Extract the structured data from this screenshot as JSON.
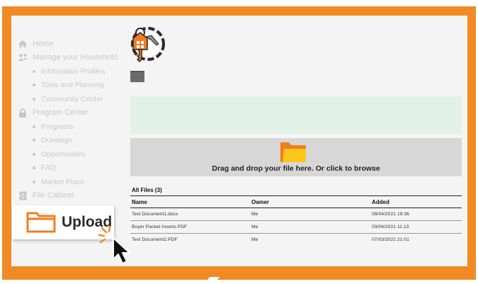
{
  "sidebar": {
    "items": [
      {
        "label": "Home",
        "type": "main",
        "icon": "home-icon"
      },
      {
        "label": "Manage your Household",
        "type": "main",
        "icon": "people-icon"
      },
      {
        "label": "Information Profiles",
        "type": "sub"
      },
      {
        "label": "Tools and Planning",
        "type": "sub"
      },
      {
        "label": "Community Center",
        "type": "sub"
      },
      {
        "label": "Program Center",
        "type": "main",
        "icon": "lock-icon"
      },
      {
        "label": "Programs",
        "type": "sub"
      },
      {
        "label": "Drawings",
        "type": "sub"
      },
      {
        "label": "Opportunities",
        "type": "sub"
      },
      {
        "label": "FAQ",
        "type": "sub"
      },
      {
        "label": "Market Place",
        "type": "sub"
      },
      {
        "label": "File Cabinet",
        "type": "main",
        "icon": "cabinet-icon"
      }
    ]
  },
  "dropzone": {
    "text": "Drag and drop your file here. Or click to browse"
  },
  "files": {
    "title": "All Files (3)",
    "columns": [
      "Name",
      "Owner",
      "Added"
    ],
    "rows": [
      {
        "name": "Text Document1.docx",
        "owner": "Me",
        "added": "09/04/2021 19:36"
      },
      {
        "name": "Buyer Packet Inserts.PDF",
        "owner": "Me",
        "added": "03/04/2021 11:13"
      },
      {
        "name": "Text Document2.PDF",
        "owner": "Me",
        "added": "07/03/2021 21:01"
      }
    ]
  },
  "upload": {
    "label": "Upload"
  },
  "colors": {
    "accent": "#f08a24",
    "folder": "#ffc61a",
    "green_bar": "#e2f1e8",
    "dropzone": "#d7d7d7"
  }
}
